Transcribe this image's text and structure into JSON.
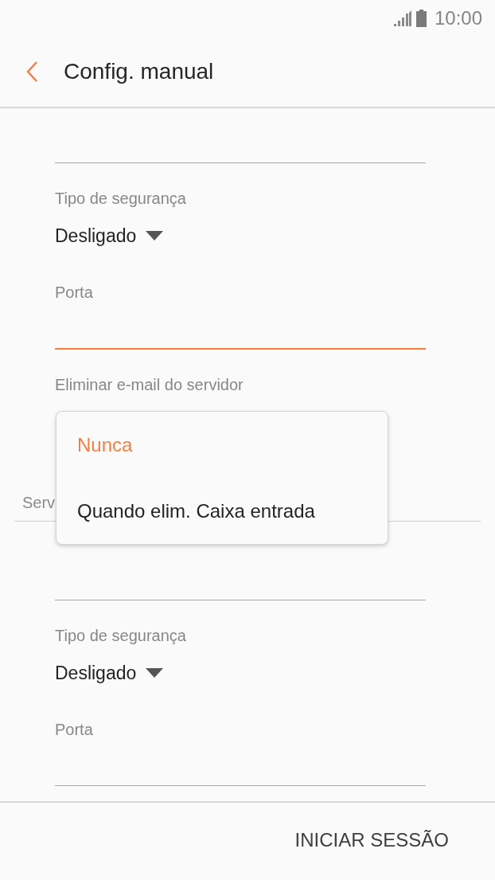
{
  "status_bar": {
    "time": "10:00"
  },
  "header": {
    "title": "Config. manual"
  },
  "incoming": {
    "fields": [
      {
        "kind": "text",
        "focused": false
      },
      {
        "kind": "select",
        "label": "Tipo de segurança",
        "value": "Desligado"
      },
      {
        "kind": "text",
        "label": "Porta",
        "focused": true
      },
      {
        "kind": "select",
        "label": "Eliminar e-mail do servidor"
      }
    ]
  },
  "section_header": "Serv",
  "outgoing": {
    "fields": [
      {
        "kind": "text",
        "focused": false
      },
      {
        "kind": "select",
        "label": "Tipo de segurança",
        "value": "Desligado"
      },
      {
        "kind": "text",
        "label": "Porta",
        "focused": false
      }
    ]
  },
  "dropdown_menu": {
    "options": [
      {
        "label": "Nunca",
        "selected": true
      },
      {
        "label": "Quando elim. Caixa entrada",
        "selected": false
      }
    ]
  },
  "footer": {
    "button": "INICIAR SESSÃO"
  }
}
